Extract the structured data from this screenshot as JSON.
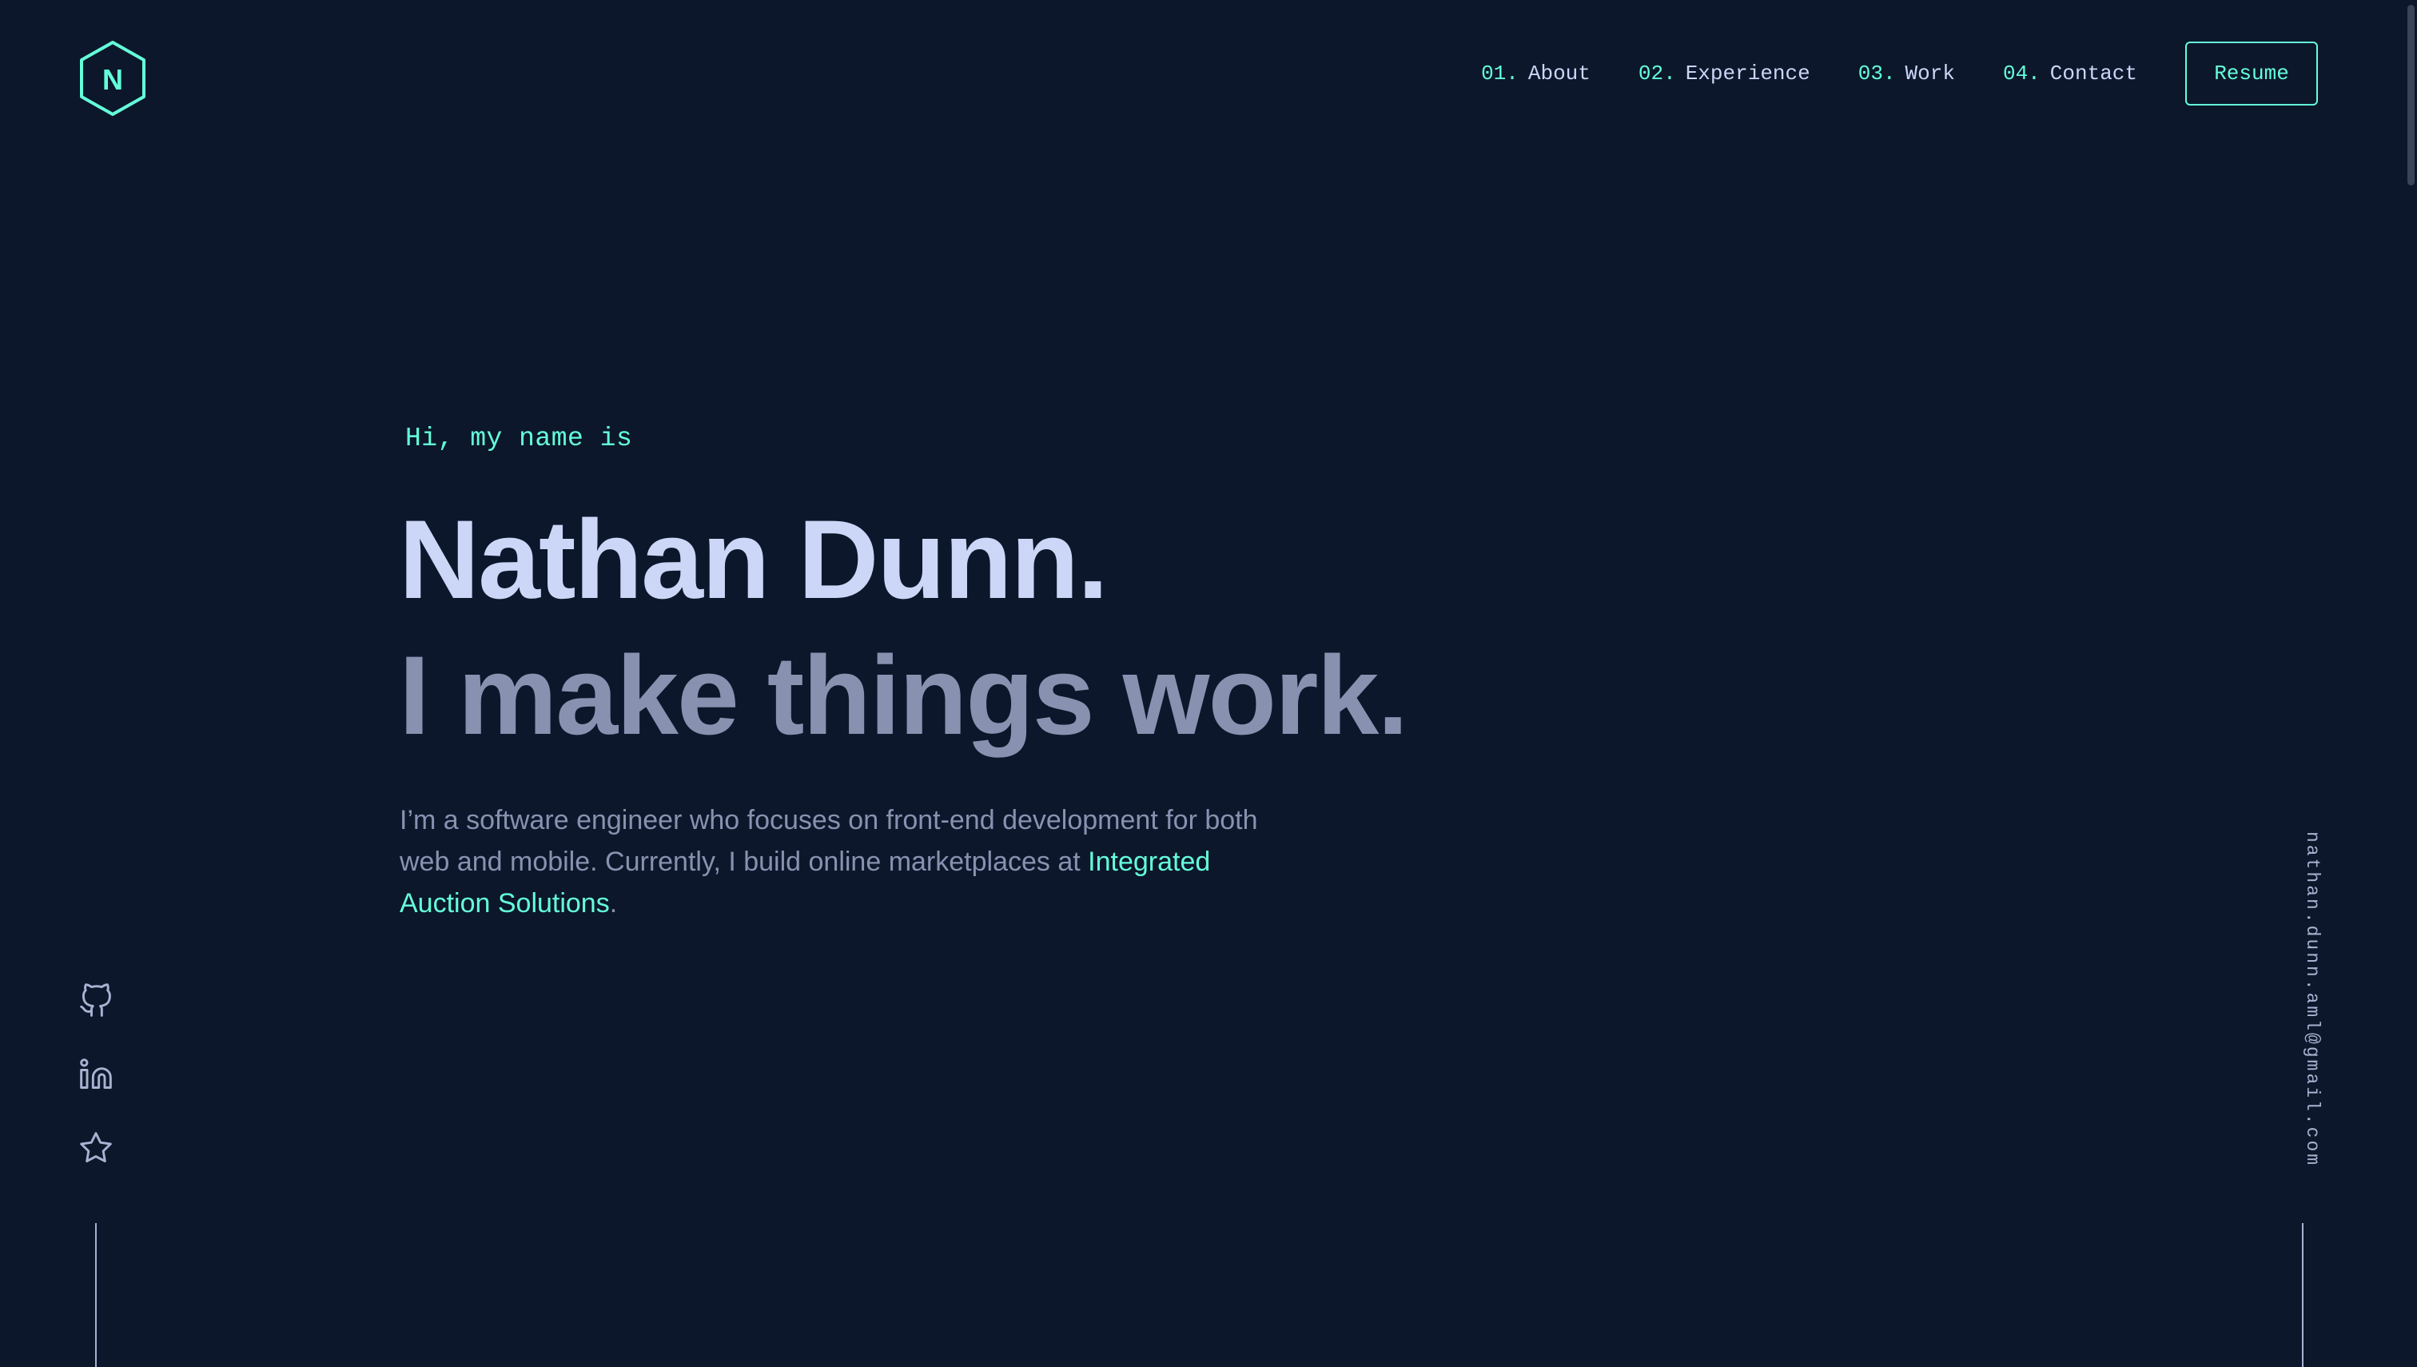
{
  "nav": {
    "items": [
      {
        "num": "01.",
        "label": "About"
      },
      {
        "num": "02.",
        "label": "Experience"
      },
      {
        "num": "03.",
        "label": "Work"
      },
      {
        "num": "04.",
        "label": "Contact"
      }
    ],
    "resume_label": "Resume"
  },
  "logo": {
    "letter": "N",
    "icon": "hexagon-logo-icon"
  },
  "hero": {
    "greeting": "Hi, my name is",
    "name": "Nathan Dunn.",
    "tagline": "I make things work.",
    "bio_text": "I’m a software engineer who focuses on front-end development for both web and mobile. Currently, I build online marketplaces at ",
    "bio_link": "Integrated Auction Solutions",
    "bio_end": "."
  },
  "socials": [
    {
      "icon": "github-icon"
    },
    {
      "icon": "linkedin-icon"
    },
    {
      "icon": "star-icon"
    }
  ],
  "email": "nathan.dunn.aml@gmail.com",
  "colors": {
    "background": "#0c172b",
    "accent": "#64ffda",
    "heading": "#ccd6f6",
    "muted": "#8892b0"
  }
}
